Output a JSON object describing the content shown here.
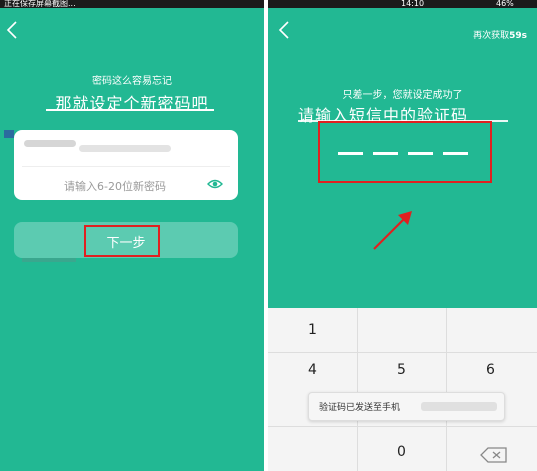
{
  "left": {
    "statusbar": {
      "text": "正在保存屏幕截图..."
    },
    "hint": "密码这么容易忘记",
    "title": "那就设定个新密码吧",
    "password_placeholder": "请输入6-20位新密码",
    "next_button": "下一步"
  },
  "right": {
    "statusbar": {
      "time": "14:10",
      "battery": "46%"
    },
    "resend_label": "再次获取",
    "resend_seconds": "59s",
    "success_text": "只差一步，您就设定成功了",
    "title": "请输入短信中的验证码",
    "keypad": {
      "keys": [
        "1",
        "4",
        "5",
        "6",
        "0"
      ]
    },
    "toast": "验证码已发送至手机"
  },
  "colors": {
    "background": "#22b893",
    "highlight_box": "#e02020",
    "button": "#5ccbb1"
  },
  "icons": [
    "back-arrow-icon",
    "eye-icon",
    "red-arrow-icon",
    "backspace-icon"
  ]
}
